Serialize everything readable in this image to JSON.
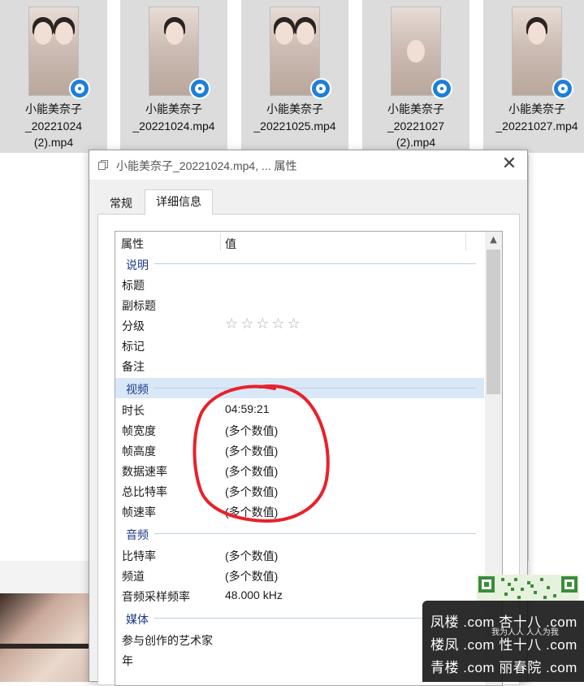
{
  "files": [
    {
      "name": "小能美奈子\n_20221024\n(2).mp4"
    },
    {
      "name": "小能美奈子\n_20221024.mp4"
    },
    {
      "name": "小能美奈子\n_20221025.mp4"
    },
    {
      "name": "小能美奈子\n_20221027\n(2).mp4"
    },
    {
      "name": "小能美奈子\n_20221027.mp4"
    }
  ],
  "dialog": {
    "title": "小能美奈子_20221024.mp4, ... 属性",
    "close_glyph": "✕",
    "tabs": [
      {
        "label": "常规"
      },
      {
        "label": "详细信息"
      }
    ],
    "header": {
      "property": "属性",
      "value": "值"
    },
    "groups": {
      "description": "说明",
      "video": "视频",
      "audio": "音频",
      "media": "媒体"
    },
    "rows": {
      "title": {
        "k": "标题",
        "v": ""
      },
      "subtitle": {
        "k": "副标题",
        "v": ""
      },
      "rating": {
        "k": "分级",
        "stars": "☆☆☆☆☆"
      },
      "tags": {
        "k": "标记",
        "v": ""
      },
      "comments": {
        "k": "备注",
        "v": ""
      },
      "length": {
        "k": "时长",
        "v": "04:59:21"
      },
      "frame_width": {
        "k": "帧宽度",
        "v": "(多个数值)"
      },
      "frame_height": {
        "k": "帧高度",
        "v": "(多个数值)"
      },
      "data_rate": {
        "k": "数据速率",
        "v": "(多个数值)"
      },
      "total_bitrate": {
        "k": "总比特率",
        "v": "(多个数值)"
      },
      "frame_rate": {
        "k": "帧速率",
        "v": "(多个数值)"
      },
      "audio_bitrate": {
        "k": "比特率",
        "v": "(多个数值)"
      },
      "channels": {
        "k": "频道",
        "v": "(多个数值)"
      },
      "sample_rate": {
        "k": "音频采样频率",
        "v": "48.000 kHz"
      },
      "contributing_artists": {
        "k": "参与创作的艺术家",
        "v": ""
      },
      "year": {
        "k": "年",
        "v": ""
      }
    },
    "scroll_up_glyph": "▲"
  },
  "watermark": {
    "small_text": "我为人人 人人为我",
    "lines": [
      "凤楼 .com  杏十八 .com",
      "楼凤 .com  性十八 .com",
      "青楼 .com  丽春院 .com"
    ]
  },
  "colors": {
    "accent_group": "#1e3a8a",
    "selection": "#d9e8f7",
    "annotation": "#e8212a"
  }
}
